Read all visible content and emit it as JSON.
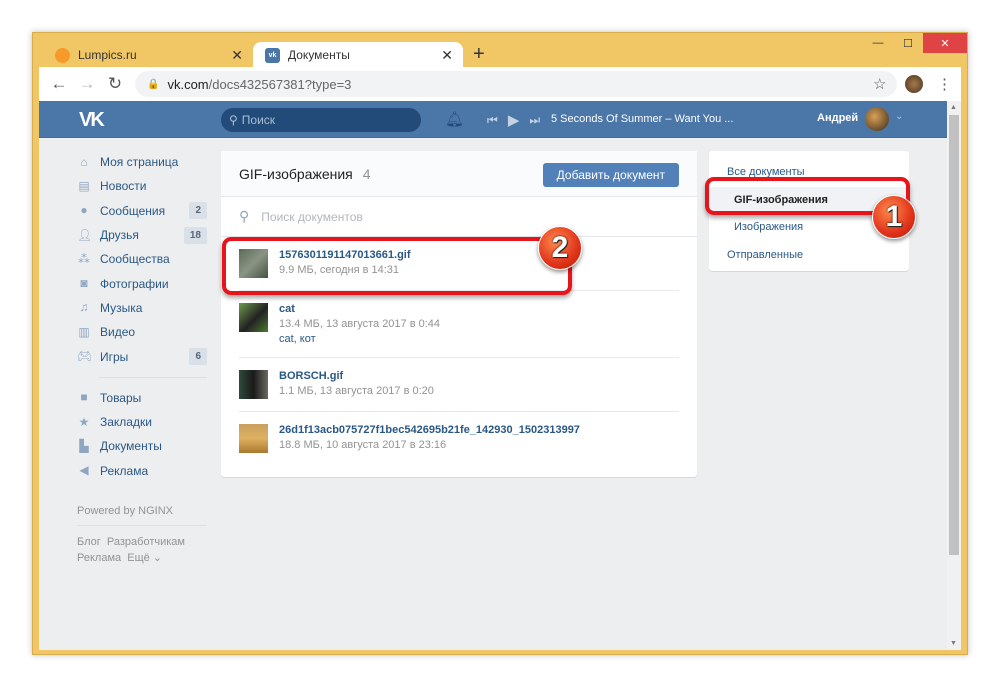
{
  "browser": {
    "tabs": [
      {
        "label": "Lumpics.ru",
        "active": false
      },
      {
        "label": "Документы",
        "active": true
      }
    ],
    "url_host": "vk.com",
    "url_path": "/docs432567381?type=3"
  },
  "vk": {
    "search_placeholder": "Поиск",
    "now_playing": "5 Seconds Of Summer – Want You ...",
    "user_name": "Андрей",
    "brand_color": "#4a76a8"
  },
  "left_nav": {
    "items": [
      {
        "label": "Моя страница",
        "icon": "home-icon"
      },
      {
        "label": "Новости",
        "icon": "news-icon"
      },
      {
        "label": "Сообщения",
        "icon": "messages-icon",
        "count": "2"
      },
      {
        "label": "Друзья",
        "icon": "friends-icon",
        "count": "18"
      },
      {
        "label": "Сообщества",
        "icon": "groups-icon"
      },
      {
        "label": "Фотографии",
        "icon": "camera-icon"
      },
      {
        "label": "Музыка",
        "icon": "music-icon"
      },
      {
        "label": "Видео",
        "icon": "video-icon"
      },
      {
        "label": "Игры",
        "icon": "gamepad-icon",
        "count": "6"
      }
    ],
    "items2": [
      {
        "label": "Товары",
        "icon": "bag-icon"
      },
      {
        "label": "Закладки",
        "icon": "star-icon"
      },
      {
        "label": "Документы",
        "icon": "document-icon"
      },
      {
        "label": "Реклама",
        "icon": "megaphone-icon"
      }
    ],
    "powered": "Powered by NGINX",
    "footer": [
      "Блог",
      "Разработчикам",
      "Реклама",
      "Ещё ⌄"
    ]
  },
  "docs": {
    "title": "GIF-изображения",
    "count": "4",
    "add_button": "Добавить документ",
    "search_placeholder": "Поиск документов",
    "items": [
      {
        "name": "1576301191147013661.gif",
        "meta": "9.9 МБ, сегодня в 14:31"
      },
      {
        "name": "cat",
        "meta": "13.4 МБ, 13 августа 2017 в 0:44",
        "tags": "cat, кот"
      },
      {
        "name": "BORSCH.gif",
        "meta": "1.1 МБ, 13 августа 2017 в 0:20"
      },
      {
        "name": "26d1f13acb075727f1bec542695b21fe_142930_1502313997",
        "meta": "18.8 МБ, 10 августа 2017 в 23:16"
      }
    ]
  },
  "right_nav": {
    "items": [
      "Все документы",
      "GIF-изображения",
      "Изображения",
      "Отправленные"
    ]
  },
  "annotations": {
    "badge1": "1",
    "badge2": "2"
  }
}
